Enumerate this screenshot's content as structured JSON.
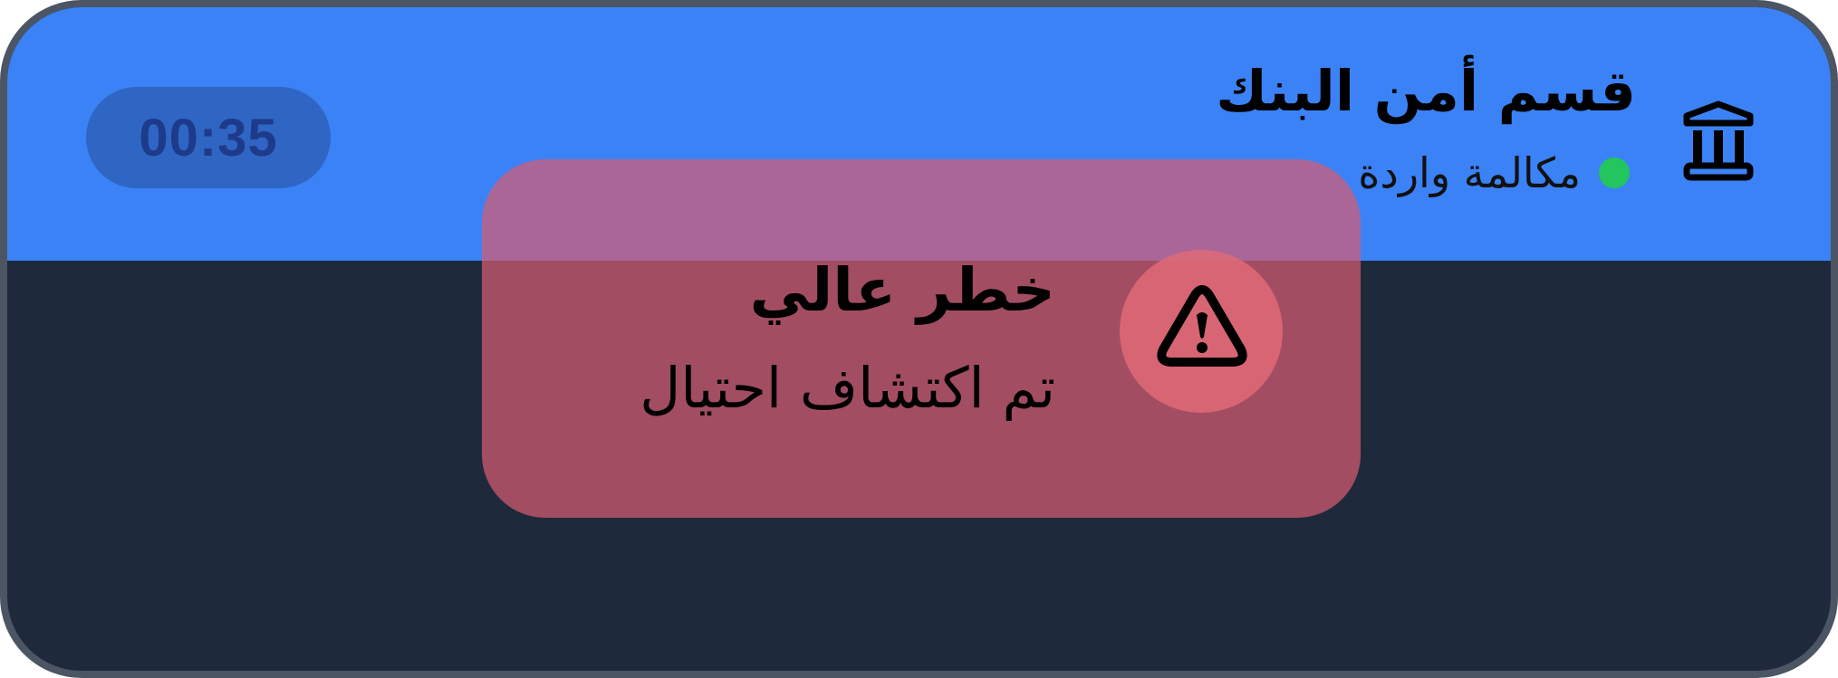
{
  "call": {
    "caller_name": "قسم أمن البنك",
    "status": "مكالمة واردة",
    "status_color": "#22c55e",
    "timer": "00:35",
    "caller_icon": "bank-icon"
  },
  "alert": {
    "title": "خطر عالي",
    "message": "تم اكتشاف احتيال",
    "icon": "warning-triangle-icon",
    "color": "#d65c71"
  },
  "theme": {
    "header_bg": "#3b82f6",
    "body_bg": "#1e293b",
    "border": "#4b5563"
  }
}
